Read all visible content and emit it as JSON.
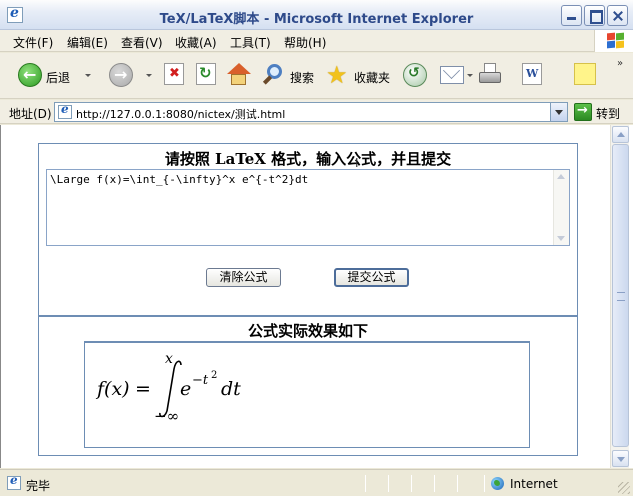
{
  "window": {
    "title": "TeX/LaTeX脚本 - Microsoft Internet Explorer"
  },
  "menu": {
    "items": [
      "文件(F)",
      "编辑(E)",
      "查看(V)",
      "收藏(A)",
      "工具(T)",
      "帮助(H)"
    ]
  },
  "toolbar": {
    "back_label": "后退",
    "search_label": "搜索",
    "favorites_label": "收藏夹"
  },
  "address": {
    "label": "地址(D)",
    "url": "http://127.0.0.1:8080/nictex/测试.html",
    "go_label": "转到"
  },
  "form": {
    "title": "请按照 LaTeX 格式，输入公式，并且提交",
    "input_value": "\\Large f(x)=\\int_{-\\infty}^x e^{-t^2}dt",
    "clear_label": "清除公式",
    "submit_label": "提交公式"
  },
  "result": {
    "title": "公式实际效果如下",
    "formula": {
      "lhs": "f(x)",
      "eq": "=",
      "upper": "x",
      "lower": "−∞",
      "base": "e",
      "exponent": "−t",
      "exponent_power": "2",
      "tail": "dt"
    }
  },
  "status": {
    "text": "完毕",
    "zone": "Internet"
  },
  "colors": {
    "panel_border": "#6d8db4",
    "title_text": "#2e4a8a"
  }
}
